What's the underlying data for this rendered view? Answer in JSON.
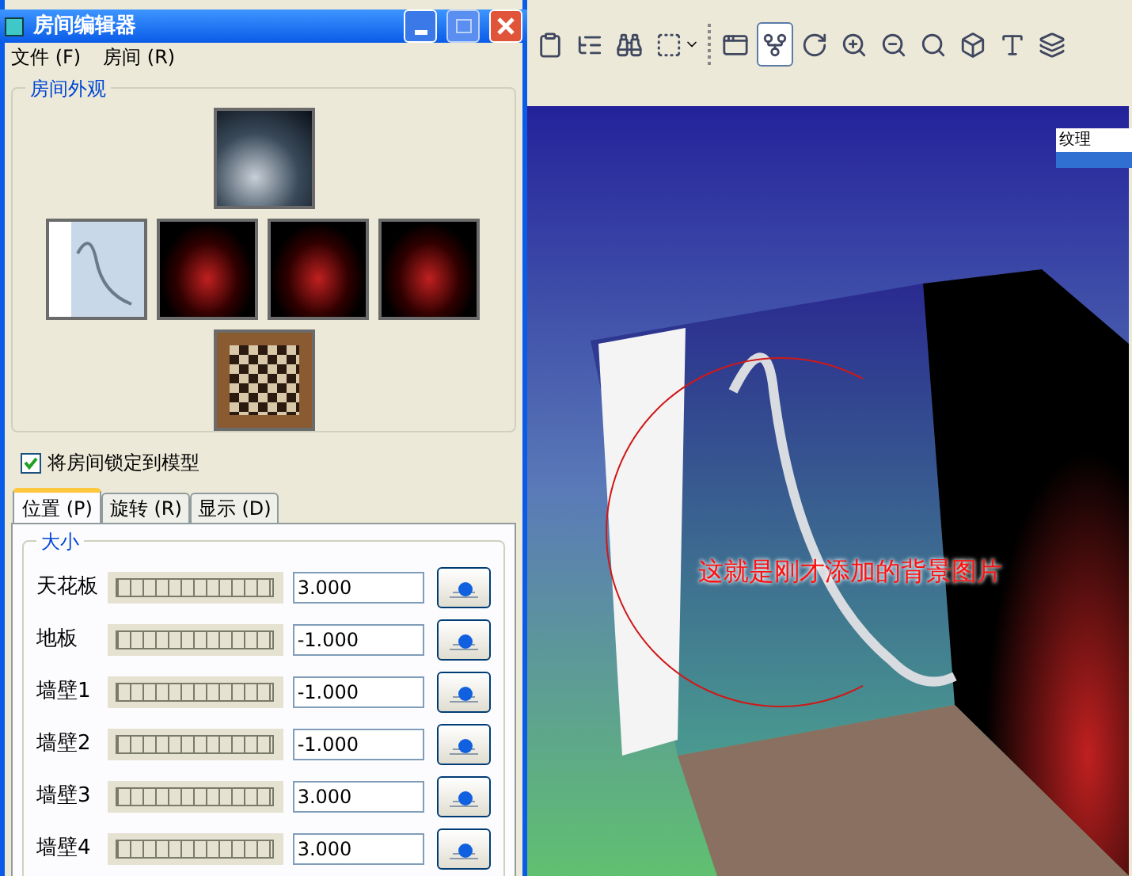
{
  "dialog": {
    "title": "房间编辑器",
    "menu": [
      "文件 (F)",
      "房间 (R)"
    ],
    "appearance": {
      "title": "房间外观",
      "tiles": [
        {
          "kind": "sky"
        },
        {
          "kind": "wave"
        },
        {
          "kind": "glow"
        },
        {
          "kind": "glow"
        },
        {
          "kind": "glow"
        },
        {
          "kind": "chess"
        }
      ]
    },
    "lock": {
      "label": "将房间锁定到模型",
      "checked": true
    },
    "tabs": [
      {
        "label": "位置 (P)",
        "selected": true
      },
      {
        "label": "旋转 (R)",
        "selected": false
      },
      {
        "label": "显示 (D)",
        "selected": false
      }
    ],
    "size": {
      "title": "大小",
      "rows": [
        {
          "label": "天花板",
          "value": "3.000"
        },
        {
          "label": "地板",
          "value": "-1.000"
        },
        {
          "label": "墙壁1",
          "value": "-1.000"
        },
        {
          "label": "墙壁2",
          "value": "-1.000"
        },
        {
          "label": "墙壁3",
          "value": "3.000"
        },
        {
          "label": "墙壁4",
          "value": "3.000"
        }
      ]
    }
  },
  "toolbar": [
    {
      "kind": "clipboard",
      "selected": false
    },
    {
      "kind": "list",
      "selected": false
    },
    {
      "kind": "binoculars",
      "selected": false
    },
    {
      "kind": "select",
      "selected": false
    },
    {
      "kind": "window",
      "sep_before": true,
      "selected": false
    },
    {
      "kind": "node",
      "selected": true
    },
    {
      "kind": "rotate",
      "selected": false
    },
    {
      "kind": "zoomin",
      "selected": false
    },
    {
      "kind": "zoomout",
      "selected": false
    },
    {
      "kind": "zoomwin",
      "selected": false
    },
    {
      "kind": "box",
      "selected": false
    },
    {
      "kind": "ab",
      "selected": false
    },
    {
      "kind": "layers",
      "selected": false
    }
  ],
  "viewport": {
    "corner_label": "纹理",
    "annotation": "这就是刚才添加的背景图片"
  }
}
